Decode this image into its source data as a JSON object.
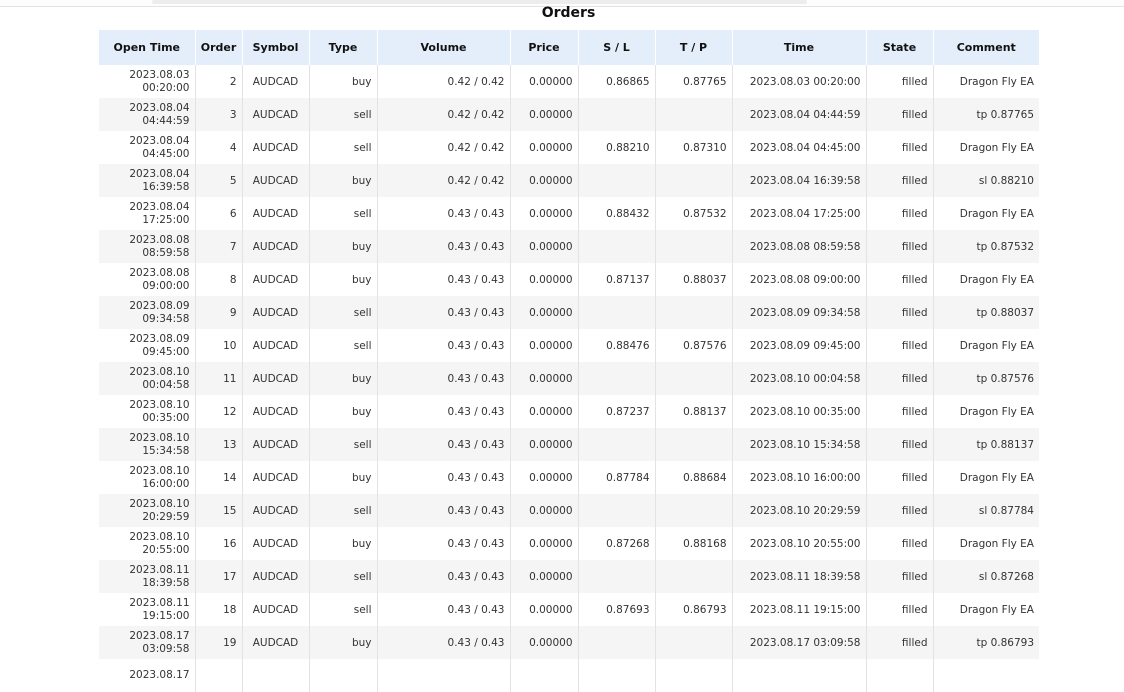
{
  "title": "Orders",
  "columns": [
    "Open Time",
    "Order",
    "Symbol",
    "Type",
    "Volume",
    "Price",
    "S / L",
    "T / P",
    "Time",
    "State",
    "Comment"
  ],
  "rows": [
    {
      "open_time": "2023.08.03 00:20:00",
      "order": "2",
      "symbol": "AUDCAD",
      "type": "buy",
      "volume": "0.42 / 0.42",
      "price": "0.00000",
      "sl": "0.86865",
      "tp": "0.87765",
      "time": "2023.08.03 00:20:00",
      "state": "filled",
      "comment": "Dragon Fly EA"
    },
    {
      "open_time": "2023.08.04 04:44:59",
      "order": "3",
      "symbol": "AUDCAD",
      "type": "sell",
      "volume": "0.42 / 0.42",
      "price": "0.00000",
      "sl": "",
      "tp": "",
      "time": "2023.08.04 04:44:59",
      "state": "filled",
      "comment": "tp 0.87765"
    },
    {
      "open_time": "2023.08.04 04:45:00",
      "order": "4",
      "symbol": "AUDCAD",
      "type": "sell",
      "volume": "0.42 / 0.42",
      "price": "0.00000",
      "sl": "0.88210",
      "tp": "0.87310",
      "time": "2023.08.04 04:45:00",
      "state": "filled",
      "comment": "Dragon Fly EA"
    },
    {
      "open_time": "2023.08.04 16:39:58",
      "order": "5",
      "symbol": "AUDCAD",
      "type": "buy",
      "volume": "0.42 / 0.42",
      "price": "0.00000",
      "sl": "",
      "tp": "",
      "time": "2023.08.04 16:39:58",
      "state": "filled",
      "comment": "sl 0.88210"
    },
    {
      "open_time": "2023.08.04 17:25:00",
      "order": "6",
      "symbol": "AUDCAD",
      "type": "sell",
      "volume": "0.43 / 0.43",
      "price": "0.00000",
      "sl": "0.88432",
      "tp": "0.87532",
      "time": "2023.08.04 17:25:00",
      "state": "filled",
      "comment": "Dragon Fly EA"
    },
    {
      "open_time": "2023.08.08 08:59:58",
      "order": "7",
      "symbol": "AUDCAD",
      "type": "buy",
      "volume": "0.43 / 0.43",
      "price": "0.00000",
      "sl": "",
      "tp": "",
      "time": "2023.08.08 08:59:58",
      "state": "filled",
      "comment": "tp 0.87532"
    },
    {
      "open_time": "2023.08.08 09:00:00",
      "order": "8",
      "symbol": "AUDCAD",
      "type": "buy",
      "volume": "0.43 / 0.43",
      "price": "0.00000",
      "sl": "0.87137",
      "tp": "0.88037",
      "time": "2023.08.08 09:00:00",
      "state": "filled",
      "comment": "Dragon Fly EA"
    },
    {
      "open_time": "2023.08.09 09:34:58",
      "order": "9",
      "symbol": "AUDCAD",
      "type": "sell",
      "volume": "0.43 / 0.43",
      "price": "0.00000",
      "sl": "",
      "tp": "",
      "time": "2023.08.09 09:34:58",
      "state": "filled",
      "comment": "tp 0.88037"
    },
    {
      "open_time": "2023.08.09 09:45:00",
      "order": "10",
      "symbol": "AUDCAD",
      "type": "sell",
      "volume": "0.43 / 0.43",
      "price": "0.00000",
      "sl": "0.88476",
      "tp": "0.87576",
      "time": "2023.08.09 09:45:00",
      "state": "filled",
      "comment": "Dragon Fly EA"
    },
    {
      "open_time": "2023.08.10 00:04:58",
      "order": "11",
      "symbol": "AUDCAD",
      "type": "buy",
      "volume": "0.43 / 0.43",
      "price": "0.00000",
      "sl": "",
      "tp": "",
      "time": "2023.08.10 00:04:58",
      "state": "filled",
      "comment": "tp 0.87576"
    },
    {
      "open_time": "2023.08.10 00:35:00",
      "order": "12",
      "symbol": "AUDCAD",
      "type": "buy",
      "volume": "0.43 / 0.43",
      "price": "0.00000",
      "sl": "0.87237",
      "tp": "0.88137",
      "time": "2023.08.10 00:35:00",
      "state": "filled",
      "comment": "Dragon Fly EA"
    },
    {
      "open_time": "2023.08.10 15:34:58",
      "order": "13",
      "symbol": "AUDCAD",
      "type": "sell",
      "volume": "0.43 / 0.43",
      "price": "0.00000",
      "sl": "",
      "tp": "",
      "time": "2023.08.10 15:34:58",
      "state": "filled",
      "comment": "tp 0.88137"
    },
    {
      "open_time": "2023.08.10 16:00:00",
      "order": "14",
      "symbol": "AUDCAD",
      "type": "buy",
      "volume": "0.43 / 0.43",
      "price": "0.00000",
      "sl": "0.87784",
      "tp": "0.88684",
      "time": "2023.08.10 16:00:00",
      "state": "filled",
      "comment": "Dragon Fly EA"
    },
    {
      "open_time": "2023.08.10 20:29:59",
      "order": "15",
      "symbol": "AUDCAD",
      "type": "sell",
      "volume": "0.43 / 0.43",
      "price": "0.00000",
      "sl": "",
      "tp": "",
      "time": "2023.08.10 20:29:59",
      "state": "filled",
      "comment": "sl 0.87784"
    },
    {
      "open_time": "2023.08.10 20:55:00",
      "order": "16",
      "symbol": "AUDCAD",
      "type": "buy",
      "volume": "0.43 / 0.43",
      "price": "0.00000",
      "sl": "0.87268",
      "tp": "0.88168",
      "time": "2023.08.10 20:55:00",
      "state": "filled",
      "comment": "Dragon Fly EA"
    },
    {
      "open_time": "2023.08.11 18:39:58",
      "order": "17",
      "symbol": "AUDCAD",
      "type": "sell",
      "volume": "0.43 / 0.43",
      "price": "0.00000",
      "sl": "",
      "tp": "",
      "time": "2023.08.11 18:39:58",
      "state": "filled",
      "comment": "sl 0.87268"
    },
    {
      "open_time": "2023.08.11 19:15:00",
      "order": "18",
      "symbol": "AUDCAD",
      "type": "sell",
      "volume": "0.43 / 0.43",
      "price": "0.00000",
      "sl": "0.87693",
      "tp": "0.86793",
      "time": "2023.08.11 19:15:00",
      "state": "filled",
      "comment": "Dragon Fly EA"
    },
    {
      "open_time": "2023.08.17 03:09:58",
      "order": "19",
      "symbol": "AUDCAD",
      "type": "buy",
      "volume": "0.43 / 0.43",
      "price": "0.00000",
      "sl": "",
      "tp": "",
      "time": "2023.08.17 03:09:58",
      "state": "filled",
      "comment": "tp 0.86793"
    },
    {
      "open_time": "2023.08.17",
      "order": "",
      "symbol": "",
      "type": "",
      "volume": "",
      "price": "",
      "sl": "",
      "tp": "",
      "time": "",
      "state": "",
      "comment": ""
    }
  ]
}
